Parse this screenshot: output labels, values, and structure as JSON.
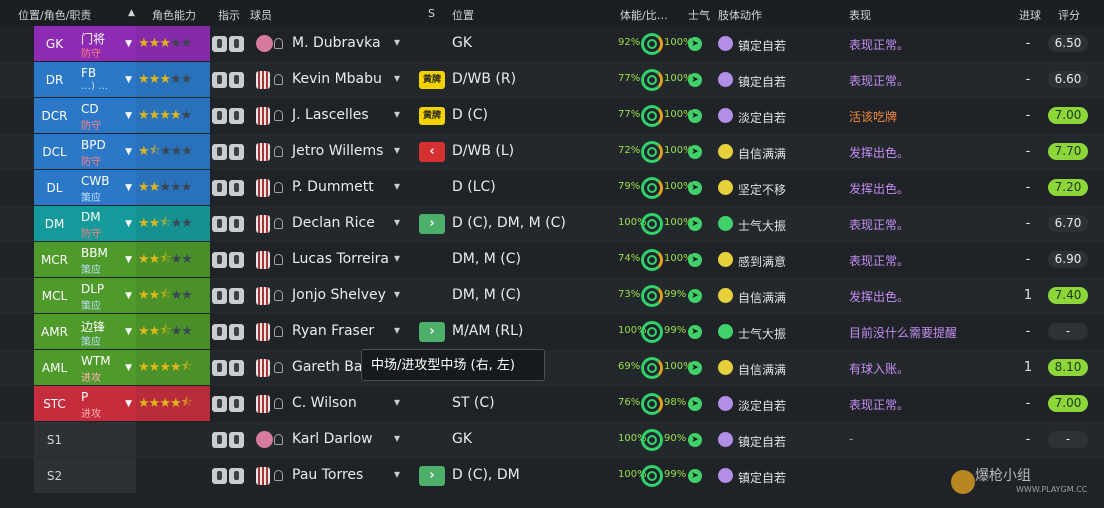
{
  "header": {
    "pos_role": "位置/角色/职责",
    "sort": "▲",
    "role_ability": "角色能力",
    "instructions": "指示",
    "player": "球员",
    "s": "S",
    "position": "位置",
    "condition": "体能/比…",
    "morale": "士气",
    "body_language": "肢体动作",
    "performance": "表现",
    "goals": "进球",
    "rating": "评分"
  },
  "colors": {
    "gk": "#8e2bb4",
    "d": "#2b78c9",
    "dm": "#149a9a",
    "m": "#4e9a2a",
    "a": "#c52c3c",
    "perf_warn": "#f08a3a",
    "perf_good": "#c48df2",
    "rating_green": "#8dd63a"
  },
  "rows": [
    {
      "pos": "GK",
      "role": "门将",
      "duty": "防守",
      "stars": 3,
      "half": false,
      "name": "M. Dubravka",
      "ppos": "GK",
      "cond": "92%",
      "sharp": "100%",
      "body": "镇定自若",
      "perf": "表现正常。",
      "goals": "-",
      "rating": "6.50",
      "card": "",
      "arrow": ""
    },
    {
      "pos": "DR",
      "role": "FB",
      "duty": "…) …",
      "stars": 3,
      "half": false,
      "name": "Kevin Mbabu",
      "ppos": "D/WB (R)",
      "cond": "77%",
      "sharp": "100%",
      "body": "镇定自若",
      "perf": "表现正常。",
      "goals": "-",
      "rating": "6.60",
      "card": "黄牌",
      "arrow": ""
    },
    {
      "pos": "DCR",
      "role": "CD",
      "duty": "防守",
      "stars": 4,
      "half": false,
      "name": "J. Lascelles",
      "ppos": "D (C)",
      "cond": "77%",
      "sharp": "100%",
      "body": "淡定自若",
      "perf": "活该吃牌",
      "goals": "-",
      "rating": "7.00",
      "card": "黄牌",
      "arrow": ""
    },
    {
      "pos": "DCL",
      "role": "BPD",
      "duty": "防守",
      "stars": 1,
      "half": true,
      "name": "Jetro Willems",
      "ppos": "D/WB (L)",
      "cond": "72%",
      "sharp": "100%",
      "body": "自信满满",
      "perf": "发挥出色。",
      "goals": "-",
      "rating": "7.70",
      "card": "",
      "arrow": "out"
    },
    {
      "pos": "DL",
      "role": "CWB",
      "duty": "策应",
      "stars": 2,
      "half": false,
      "name": "P. Dummett",
      "ppos": "D (LC)",
      "cond": "79%",
      "sharp": "100%",
      "body": "坚定不移",
      "perf": "发挥出色。",
      "goals": "-",
      "rating": "7.20",
      "card": "",
      "arrow": ""
    },
    {
      "pos": "DM",
      "role": "DM",
      "duty": "防守",
      "stars": 2,
      "half": true,
      "name": "Declan Rice",
      "ppos": "D (C), DM, M (C)",
      "cond": "100%",
      "sharp": "100%",
      "body": "士气大振",
      "perf": "表现正常。",
      "goals": "-",
      "rating": "6.70",
      "card": "",
      "arrow": "in"
    },
    {
      "pos": "MCR",
      "role": "BBM",
      "duty": "策应",
      "stars": 2,
      "half": true,
      "name": "Lucas Torreira",
      "ppos": "DM, M (C)",
      "cond": "74%",
      "sharp": "100%",
      "body": "感到满意",
      "perf": "表现正常。",
      "goals": "-",
      "rating": "6.90",
      "card": "",
      "arrow": ""
    },
    {
      "pos": "MCL",
      "role": "DLP",
      "duty": "策应",
      "stars": 2,
      "half": true,
      "name": "Jonjo Shelvey",
      "ppos": "DM, M (C)",
      "cond": "73%",
      "sharp": "99%",
      "body": "自信满满",
      "perf": "发挥出色。",
      "goals": "1",
      "rating": "7.40",
      "card": "",
      "arrow": ""
    },
    {
      "pos": "AMR",
      "role": "边锋",
      "duty": "策应",
      "stars": 2,
      "half": true,
      "name": "Ryan Fraser",
      "ppos": "M/AM (RL)",
      "cond": "100%",
      "sharp": "99%",
      "body": "士气大振",
      "perf": "目前没什么需要提醒",
      "goals": "-",
      "rating": "-",
      "card": "",
      "arrow": "in"
    },
    {
      "pos": "AML",
      "role": "WTM",
      "duty": "进攻",
      "stars": 4,
      "half": true,
      "name": "Gareth Bale",
      "ppos": "AM (RL)",
      "cond": "69%",
      "sharp": "100%",
      "body": "自信满满",
      "perf": "有球入账。",
      "goals": "1",
      "rating": "8.10",
      "card": "",
      "arrow": ""
    },
    {
      "pos": "STC",
      "role": "P",
      "duty": "进攻",
      "stars": 4,
      "half": true,
      "name": "C. Wilson",
      "ppos": "ST (C)",
      "cond": "76%",
      "sharp": "98%",
      "body": "淡定自若",
      "perf": "表现正常。",
      "goals": "-",
      "rating": "7.00",
      "card": "",
      "arrow": ""
    },
    {
      "pos": "S1",
      "role": "",
      "duty": "",
      "stars": 0,
      "half": false,
      "name": "Karl Darlow",
      "ppos": "GK",
      "cond": "100%",
      "sharp": "90%",
      "body": "镇定自若",
      "perf": "-",
      "goals": "-",
      "rating": "-",
      "card": "",
      "arrow": ""
    },
    {
      "pos": "S2",
      "role": "",
      "duty": "",
      "stars": 0,
      "half": false,
      "name": "Pau Torres",
      "ppos": "D (C), DM",
      "cond": "100%",
      "sharp": "99%",
      "body": "镇定自若",
      "perf": "",
      "goals": "",
      "rating": "",
      "card": "",
      "arrow": "in"
    }
  ],
  "tooltip": "中场/进攻型中场 (右, 左)",
  "watermark": {
    "brand": "爆枪小组",
    "url": "WWW.PLAYGM.CC"
  }
}
